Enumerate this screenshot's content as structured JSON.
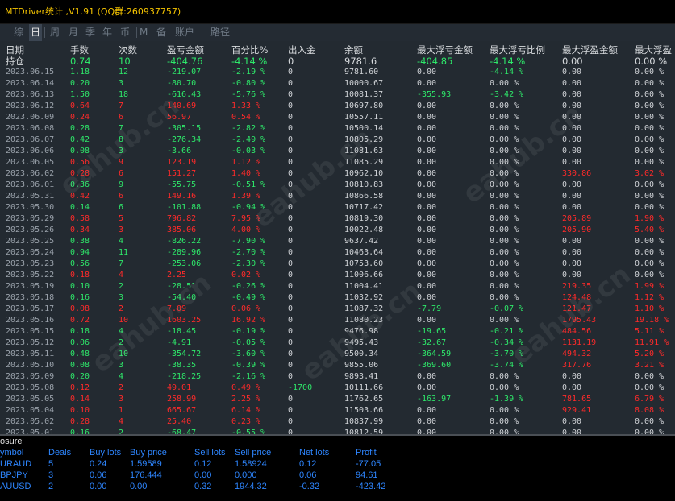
{
  "window": {
    "title": "MTDriver统计 ,V1.91 (QQ群:260937757)"
  },
  "tabs": [
    {
      "label": "综",
      "active": false
    },
    {
      "label": "日",
      "active": true
    },
    {
      "label": "周",
      "active": false
    },
    {
      "label": "月",
      "active": false
    },
    {
      "label": "季",
      "active": false
    },
    {
      "label": "年",
      "active": false
    },
    {
      "label": "币",
      "active": false
    },
    {
      "label": "M",
      "active": false
    },
    {
      "label": "备",
      "active": false
    },
    {
      "label": "账户",
      "active": false
    },
    {
      "label": "路径",
      "active": false
    }
  ],
  "table": {
    "columns": [
      "日期",
      "手数",
      "次数",
      "盈亏金额",
      "百分比%",
      "出入金",
      "余额",
      "最大浮亏金额",
      "最大浮亏比例",
      "最大浮盈金额",
      "最大浮盈"
    ],
    "holding": [
      "持仓",
      "0.74",
      "10",
      "-404.76",
      "-4.14 %",
      "0",
      "9781.6",
      "-404.85",
      "-4.14 %",
      "0.00",
      "0.00 %"
    ],
    "rows": [
      [
        "2023.06.15",
        "1.18",
        "12",
        "-219.07",
        "-2.19 %",
        "0",
        "9781.60",
        "0.00",
        "-4.14 %",
        "0.00",
        "0.00 %"
      ],
      [
        "2023.06.14",
        "0.20",
        "3",
        "-80.70",
        "-0.80 %",
        "0",
        "10000.67",
        "0.00",
        "0.00 %",
        "0.00",
        "0.00 %"
      ],
      [
        "2023.06.13",
        "1.50",
        "18",
        "-616.43",
        "-5.76 %",
        "0",
        "10081.37",
        "-355.93",
        "-3.42 %",
        "0.00",
        "0.00 %"
      ],
      [
        "2023.06.12",
        "0.64",
        "7",
        "140.69",
        "1.33 %",
        "0",
        "10697.80",
        "0.00",
        "0.00 %",
        "0.00",
        "0.00 %"
      ],
      [
        "2023.06.09",
        "0.24",
        "6",
        "56.97",
        "0.54 %",
        "0",
        "10557.11",
        "0.00",
        "0.00 %",
        "0.00",
        "0.00 %"
      ],
      [
        "2023.06.08",
        "0.28",
        "7",
        "-305.15",
        "-2.82 %",
        "0",
        "10500.14",
        "0.00",
        "0.00 %",
        "0.00",
        "0.00 %"
      ],
      [
        "2023.06.07",
        "0.42",
        "8",
        "-276.34",
        "-2.49 %",
        "0",
        "10805.29",
        "0.00",
        "0.00 %",
        "0.00",
        "0.00 %"
      ],
      [
        "2023.06.06",
        "0.08",
        "3",
        "-3.66",
        "-0.03 %",
        "0",
        "11081.63",
        "0.00",
        "0.00 %",
        "0.00",
        "0.00 %"
      ],
      [
        "2023.06.05",
        "0.56",
        "9",
        "123.19",
        "1.12 %",
        "0",
        "11085.29",
        "0.00",
        "0.00 %",
        "0.00",
        "0.00 %"
      ],
      [
        "2023.06.02",
        "0.28",
        "6",
        "151.27",
        "1.40 %",
        "0",
        "10962.10",
        "0.00",
        "0.00 %",
        "330.86",
        "3.02 %"
      ],
      [
        "2023.06.01",
        "0.36",
        "9",
        "-55.75",
        "-0.51 %",
        "0",
        "10810.83",
        "0.00",
        "0.00 %",
        "0.00",
        "0.00 %"
      ],
      [
        "2023.05.31",
        "0.42",
        "6",
        "149.16",
        "1.39 %",
        "0",
        "10866.58",
        "0.00",
        "0.00 %",
        "0.00",
        "0.00 %"
      ],
      [
        "2023.05.30",
        "0.14",
        "6",
        "-101.88",
        "-0.94 %",
        "0",
        "10717.42",
        "0.00",
        "0.00 %",
        "0.00",
        "0.00 %"
      ],
      [
        "2023.05.29",
        "0.58",
        "5",
        "796.82",
        "7.95 %",
        "0",
        "10819.30",
        "0.00",
        "0.00 %",
        "205.89",
        "1.90 %"
      ],
      [
        "2023.05.26",
        "0.34",
        "3",
        "385.06",
        "4.00 %",
        "0",
        "10022.48",
        "0.00",
        "0.00 %",
        "205.90",
        "5.40 %"
      ],
      [
        "2023.05.25",
        "0.38",
        "4",
        "-826.22",
        "-7.90 %",
        "0",
        "9637.42",
        "0.00",
        "0.00 %",
        "0.00",
        "0.00 %"
      ],
      [
        "2023.05.24",
        "0.94",
        "11",
        "-289.96",
        "-2.70 %",
        "0",
        "10463.64",
        "0.00",
        "0.00 %",
        "0.00",
        "0.00 %"
      ],
      [
        "2023.05.23",
        "0.56",
        "7",
        "-253.06",
        "-2.30 %",
        "0",
        "10753.60",
        "0.00",
        "0.00 %",
        "0.00",
        "0.00 %"
      ],
      [
        "2023.05.22",
        "0.18",
        "4",
        "2.25",
        "0.02 %",
        "0",
        "11006.66",
        "0.00",
        "0.00 %",
        "0.00",
        "0.00 %"
      ],
      [
        "2023.05.19",
        "0.10",
        "2",
        "-28.51",
        "-0.26 %",
        "0",
        "11004.41",
        "0.00",
        "0.00 %",
        "219.35",
        "1.99 %"
      ],
      [
        "2023.05.18",
        "0.16",
        "3",
        "-54.40",
        "-0.49 %",
        "0",
        "11032.92",
        "0.00",
        "0.00 %",
        "124.48",
        "1.12 %"
      ],
      [
        "2023.05.17",
        "0.08",
        "2",
        "7.09",
        "0.06 %",
        "0",
        "11087.32",
        "-7.79",
        "-0.07 %",
        "121.47",
        "1.10 %"
      ],
      [
        "2023.05.16",
        "0.72",
        "10",
        "1603.25",
        "16.92 %",
        "0",
        "11080.23",
        "0.00",
        "0.00 %",
        "1795.43",
        "19.18 %"
      ],
      [
        "2023.05.15",
        "0.18",
        "4",
        "-18.45",
        "-0.19 %",
        "0",
        "9476.98",
        "-19.65",
        "-0.21 %",
        "484.56",
        "5.11 %"
      ],
      [
        "2023.05.12",
        "0.06",
        "2",
        "-4.91",
        "-0.05 %",
        "0",
        "9495.43",
        "-32.67",
        "-0.34 %",
        "1131.19",
        "11.91 %"
      ],
      [
        "2023.05.11",
        "0.48",
        "10",
        "-354.72",
        "-3.60 %",
        "0",
        "9500.34",
        "-364.59",
        "-3.70 %",
        "494.32",
        "5.20 %"
      ],
      [
        "2023.05.10",
        "0.08",
        "3",
        "-38.35",
        "-0.39 %",
        "0",
        "9855.06",
        "-369.60",
        "-3.74 %",
        "317.76",
        "3.21 %"
      ],
      [
        "2023.05.09",
        "0.20",
        "4",
        "-218.25",
        "-2.16 %",
        "0",
        "9893.41",
        "0.00",
        "0.00 %",
        "0.00",
        "0.00 %"
      ],
      [
        "2023.05.08",
        "0.12",
        "2",
        "49.01",
        "0.49 %",
        "-1700",
        "10111.66",
        "0.00",
        "0.00 %",
        "0.00",
        "0.00 %"
      ],
      [
        "2023.05.05",
        "0.14",
        "3",
        "258.99",
        "2.25 %",
        "0",
        "11762.65",
        "-163.97",
        "-1.39 %",
        "781.65",
        "6.79 %"
      ],
      [
        "2023.05.04",
        "0.10",
        "1",
        "665.67",
        "6.14 %",
        "0",
        "11503.66",
        "0.00",
        "0.00 %",
        "929.41",
        "8.08 %"
      ],
      [
        "2023.05.02",
        "0.28",
        "4",
        "25.40",
        "0.23 %",
        "0",
        "10837.99",
        "0.00",
        "0.00 %",
        "0.00",
        "0.00 %"
      ],
      [
        "2023.05.01",
        "0.16",
        "2",
        "-68.47",
        "-0.55 %",
        "0",
        "10812.59",
        "0.00",
        "0.00 %",
        "0.00",
        "0.00 %"
      ]
    ]
  },
  "summary": {
    "title": "osure",
    "columns": [
      "ymbol",
      "Deals",
      "Buy lots",
      "Buy price",
      "Sell lots",
      "Sell price",
      "Net lots",
      "Profit"
    ],
    "rows": [
      [
        "URAUD",
        "5",
        "0.24",
        "1.59589",
        "0.12",
        "1.58924",
        "0.12",
        "-77.05"
      ],
      [
        "BPJPY",
        "3",
        "0.06",
        "176.444",
        "0.00",
        "0.000",
        "0.06",
        "94.61"
      ],
      [
        "AUUSD",
        "2",
        "0.00",
        "0.00",
        "0.32",
        "1944.32",
        "-0.32",
        "-423.42"
      ]
    ]
  },
  "watermark": "eahub.cn",
  "colors": {
    "profit": "#2ee86a",
    "loss": "#ff2a2a",
    "summary_text": "#2e86ff",
    "title_text": "#f5c400"
  }
}
